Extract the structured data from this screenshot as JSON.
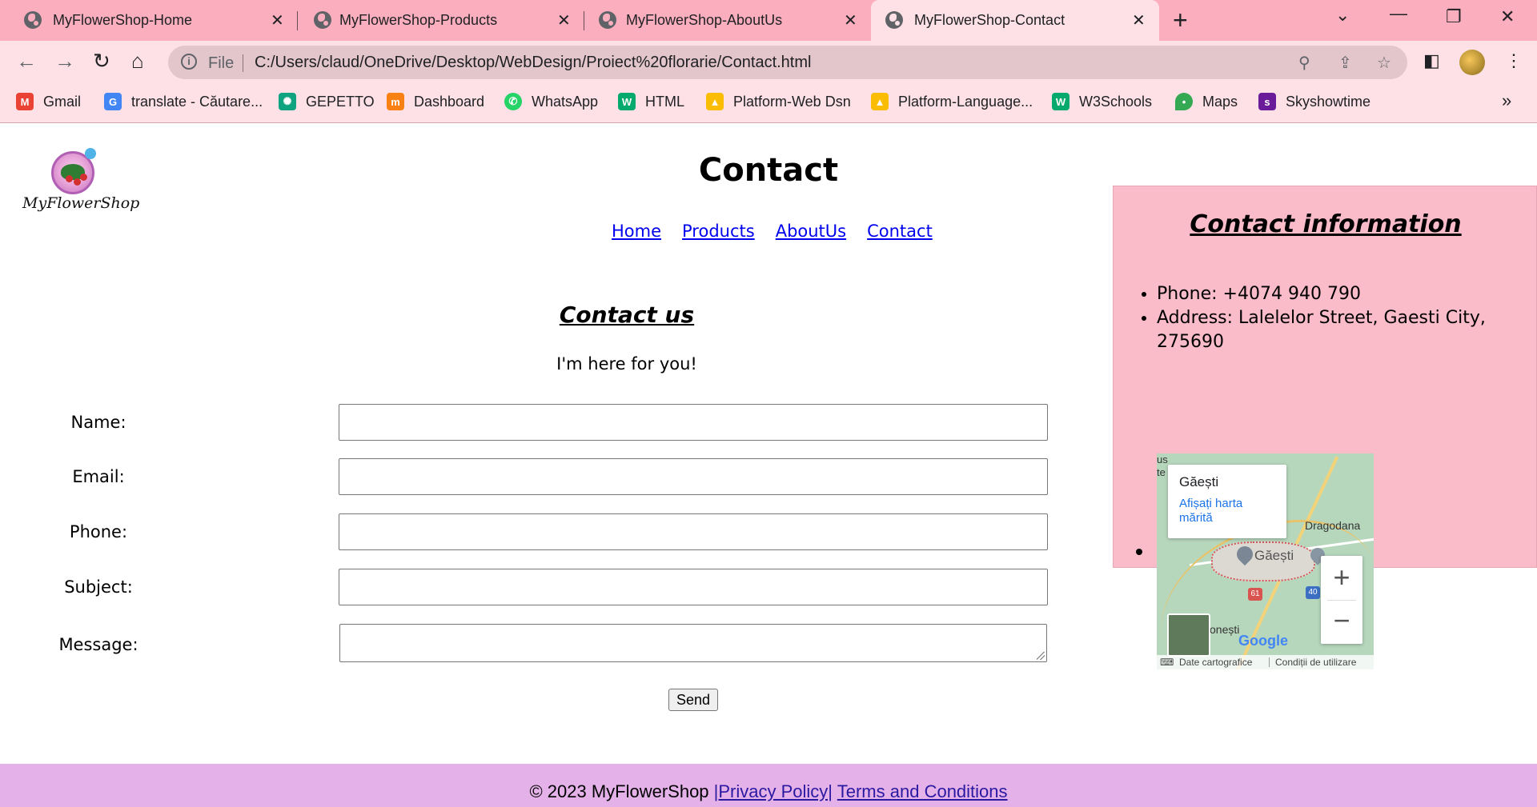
{
  "browser": {
    "tabs": [
      {
        "title": "MyFlowerShop-Home",
        "active": false
      },
      {
        "title": "MyFlowerShop-Products",
        "active": false
      },
      {
        "title": "MyFlowerShop-AboutUs",
        "active": false
      },
      {
        "title": "MyFlowerShop-Contact",
        "active": true
      }
    ],
    "close_glyph": "✕",
    "new_tab_glyph": "+",
    "address": {
      "scheme": "File",
      "url": "C:/Users/claud/OneDrive/Desktop/WebDesign/Proiect%20florarie/Contact.html"
    },
    "bookmarks": [
      {
        "label": "Gmail",
        "icon": "gmail-icon",
        "color": "#ea4335"
      },
      {
        "label": "translate - Căutare...",
        "icon": "google-icon",
        "color": "#4285f4"
      },
      {
        "label": "GEPETTO",
        "icon": "openai-icon",
        "color": "#10a37f"
      },
      {
        "label": "Dashboard",
        "icon": "moodle-icon",
        "color": "#f98012"
      },
      {
        "label": "WhatsApp",
        "icon": "whatsapp-icon",
        "color": "#25d366"
      },
      {
        "label": "HTML",
        "icon": "w3schools-icon",
        "color": "#04aa6d"
      },
      {
        "label": "Platform-Web Dsn",
        "icon": "google-drive-icon",
        "color": "#fbbc04"
      },
      {
        "label": "Platform-Language...",
        "icon": "google-drive-icon",
        "color": "#fbbc04"
      },
      {
        "label": "W3Schools",
        "icon": "w3schools-icon",
        "color": "#04aa6d"
      },
      {
        "label": "Maps",
        "icon": "google-maps-icon",
        "color": "#34a853"
      },
      {
        "label": "Skyshowtime",
        "icon": "skyshowtime-icon",
        "color": "#6a1b9a"
      }
    ],
    "overflow_glyph": "»"
  },
  "page": {
    "logo_text": "MyFlowerShop",
    "title": "Contact",
    "nav": [
      "Home",
      "Products",
      "AboutUs",
      "Contact"
    ],
    "contact_heading": "Contact us",
    "intro": "I'm here for you!",
    "form": {
      "fields": [
        {
          "label": "Name:",
          "value": ""
        },
        {
          "label": "Email:",
          "value": ""
        },
        {
          "label": "Phone:",
          "value": ""
        },
        {
          "label": "Subject:",
          "value": ""
        },
        {
          "label": "Message:",
          "value": ""
        }
      ],
      "submit_label": "Send"
    },
    "info": {
      "heading": "Contact information",
      "phone": "Phone: +4074 940 790",
      "address": "Address: Lalelelor Street, Gaesti City, 275690"
    },
    "map": {
      "place": "Găești",
      "card_link": "Afișați harta mărită",
      "town_label": "Găești",
      "labels": [
        "Dragodana",
        "onești",
        "us",
        "te"
      ],
      "route_61": "61",
      "route_40": "40",
      "zoom_in": "+",
      "zoom_out": "−",
      "google_logo": "Google",
      "attribution_data": "Date cartografice",
      "attribution_terms": "Condiții de utilizare",
      "keyboard_icon": "keyboard-icon"
    },
    "footer": {
      "copyright": "© 2023 MyFlowerShop ",
      "privacy": "|Privacy Policy|",
      "terms": "Terms and Conditions"
    }
  },
  "colors": {
    "tabstrip": "#fbaebd",
    "toolbar": "#fde1e6",
    "info_panel": "#fbbcca",
    "footer": "#e4b1e9",
    "link": "#0000ee"
  }
}
